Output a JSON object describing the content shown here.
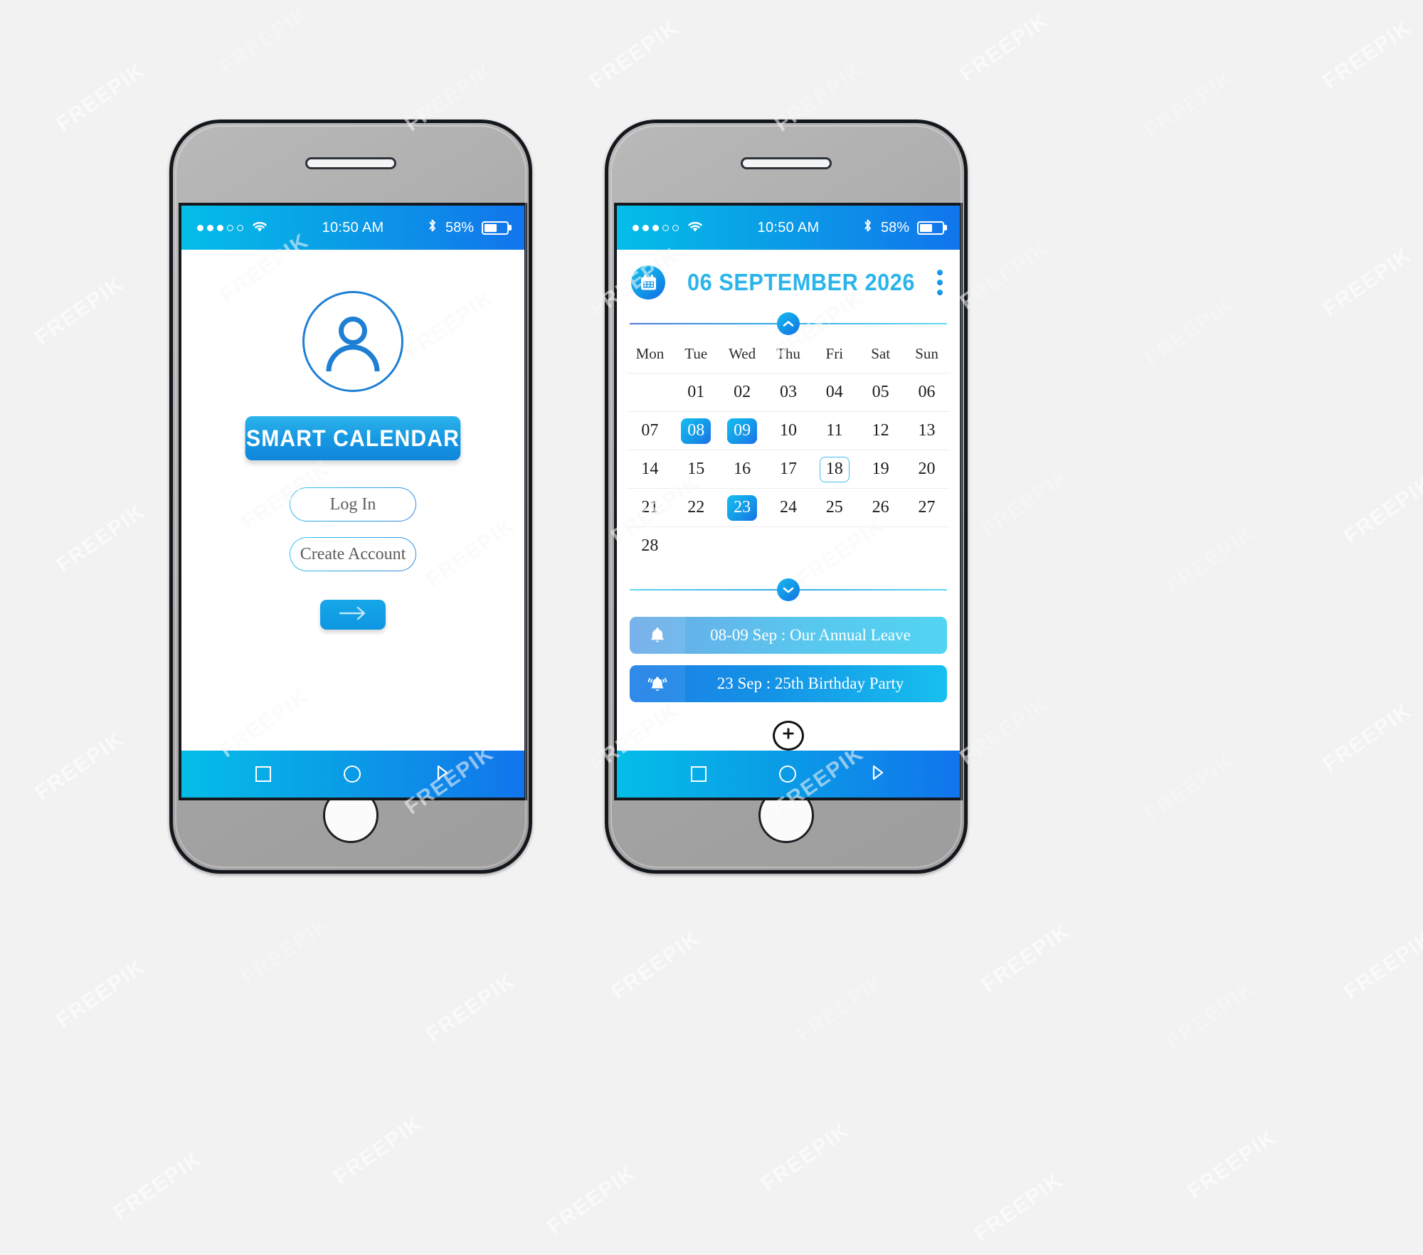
{
  "status_bar": {
    "signal_dots_filled": 3,
    "signal_dots_total": 5,
    "wifi_icon": "wifi-icon",
    "time": "10:50 AM",
    "bluetooth_icon": "bluetooth-icon",
    "battery_percent": "58%",
    "battery_fill": 58
  },
  "nav_bar": {
    "back_icon": "square-icon",
    "home_icon": "circle-icon",
    "recents_icon": "triangle-icon"
  },
  "login_screen": {
    "avatar_icon": "user-avatar-icon",
    "brand_label": "SMART CALENDAR",
    "login_label": "Log In",
    "create_account_label": "Create Account",
    "submit_icon": "arrow-right-icon"
  },
  "calendar_screen": {
    "header": {
      "app_icon": "calendar-icon",
      "title": "06 SEPTEMBER 2026",
      "menu_icon": "kebab-menu-icon"
    },
    "collapse_up_icon": "chevron-up-icon",
    "collapse_down_icon": "chevron-down-icon",
    "weekdays": [
      "Mon",
      "Tue",
      "Wed",
      "Thu",
      "Fri",
      "Sat",
      "Sun"
    ],
    "weeks": [
      [
        {
          "label": "",
          "state": "empty"
        },
        {
          "label": "01",
          "state": "normal"
        },
        {
          "label": "02",
          "state": "normal"
        },
        {
          "label": "03",
          "state": "normal"
        },
        {
          "label": "04",
          "state": "normal"
        },
        {
          "label": "05",
          "state": "normal"
        },
        {
          "label": "06",
          "state": "normal"
        }
      ],
      [
        {
          "label": "07",
          "state": "normal"
        },
        {
          "label": "08",
          "state": "selected"
        },
        {
          "label": "09",
          "state": "selected"
        },
        {
          "label": "10",
          "state": "normal"
        },
        {
          "label": "11",
          "state": "normal"
        },
        {
          "label": "12",
          "state": "normal"
        },
        {
          "label": "13",
          "state": "normal"
        }
      ],
      [
        {
          "label": "14",
          "state": "normal"
        },
        {
          "label": "15",
          "state": "normal"
        },
        {
          "label": "16",
          "state": "normal"
        },
        {
          "label": "17",
          "state": "normal"
        },
        {
          "label": "18",
          "state": "outlined"
        },
        {
          "label": "19",
          "state": "normal"
        },
        {
          "label": "20",
          "state": "normal"
        }
      ],
      [
        {
          "label": "21",
          "state": "normal"
        },
        {
          "label": "22",
          "state": "normal"
        },
        {
          "label": "23",
          "state": "selected"
        },
        {
          "label": "24",
          "state": "normal"
        },
        {
          "label": "25",
          "state": "normal"
        },
        {
          "label": "26",
          "state": "normal"
        },
        {
          "label": "27",
          "state": "normal"
        }
      ],
      [
        {
          "label": "28",
          "state": "normal"
        },
        {
          "label": "",
          "state": "empty"
        },
        {
          "label": "",
          "state": "empty"
        },
        {
          "label": "",
          "state": "empty"
        },
        {
          "label": "",
          "state": "empty"
        },
        {
          "label": "",
          "state": "empty"
        },
        {
          "label": "",
          "state": "empty"
        }
      ]
    ],
    "events": [
      {
        "icon": "bell-icon",
        "text": "08-09 Sep : Our Annual Leave"
      },
      {
        "icon": "bell-ringing-icon",
        "text": "23 Sep : 25th Birthday Party"
      }
    ],
    "add_event_icon": "plus-icon"
  },
  "watermark": {
    "text": "FREEPIK"
  },
  "colors": {
    "accent_cyan": "#04bde8",
    "accent_blue": "#1175ec",
    "title_blue": "#2ab4ea",
    "avatar_blue": "#1e7fd4",
    "page_bg": "#f2f2f2",
    "frame_gray": "#a9a9a9",
    "frame_border": "#14181c"
  }
}
